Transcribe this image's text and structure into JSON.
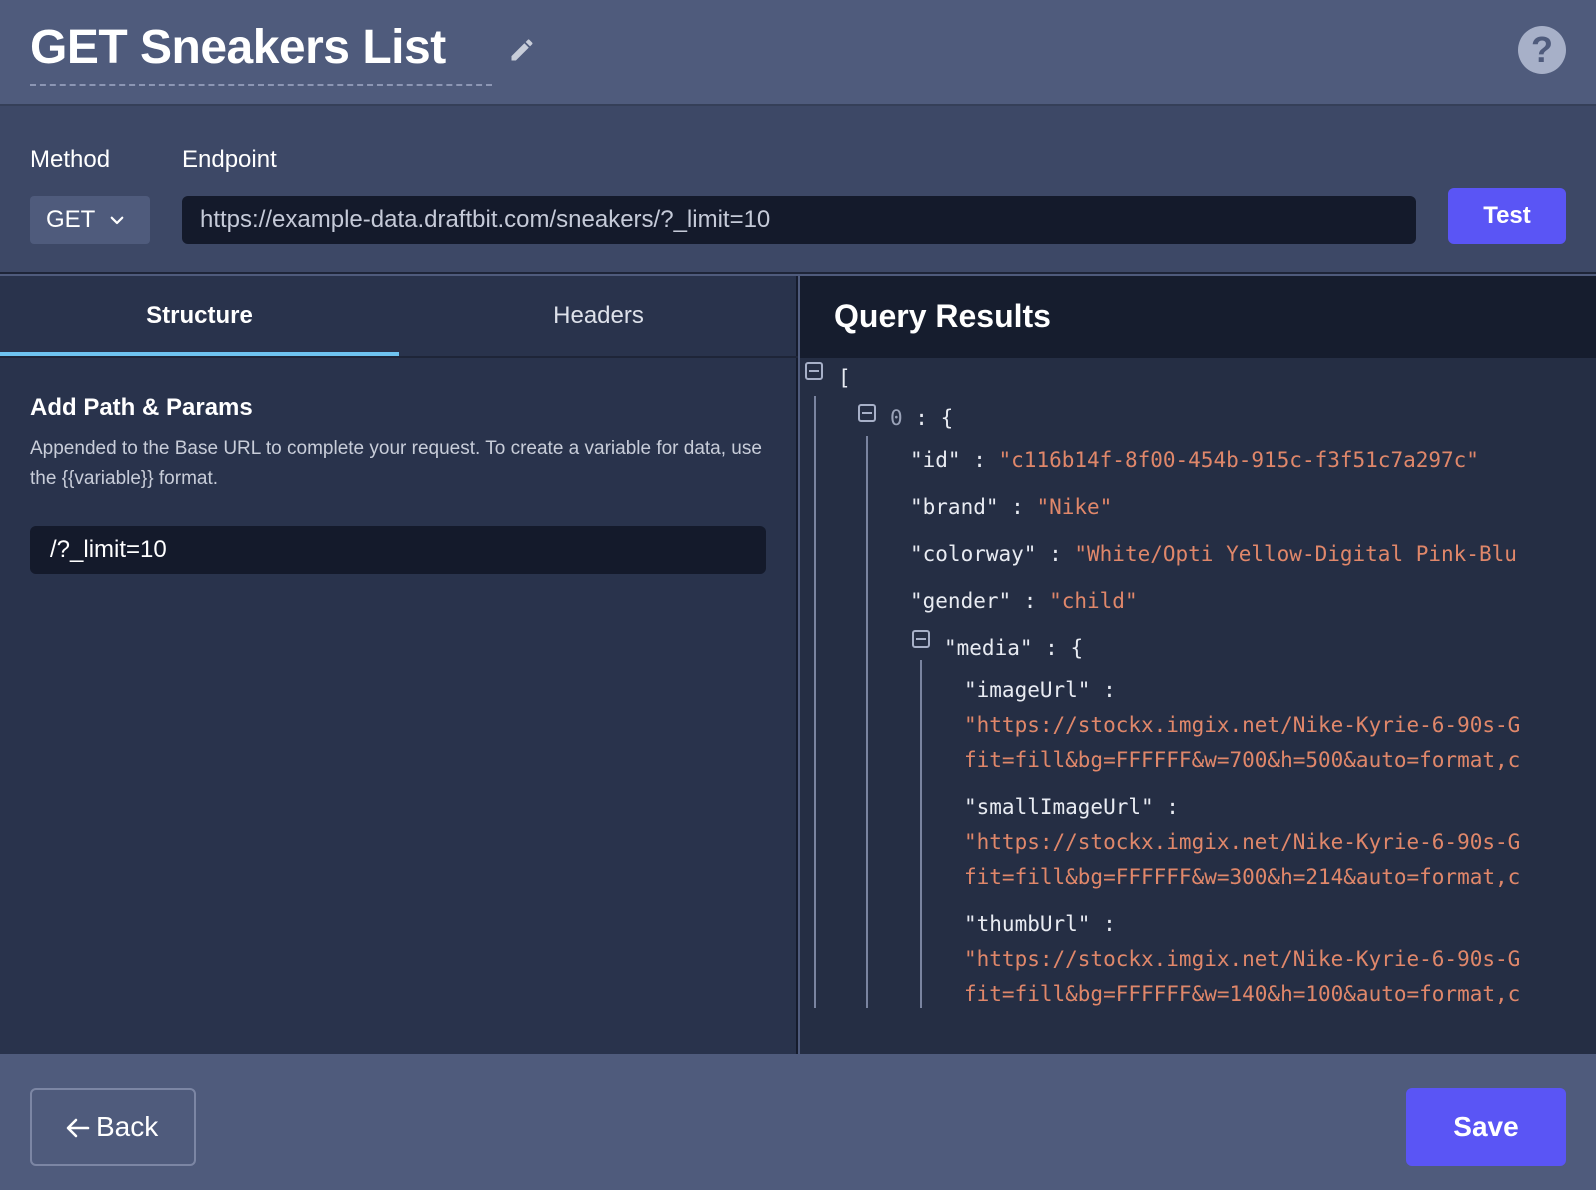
{
  "header": {
    "title": "GET Sneakers List",
    "help_label": "?"
  },
  "request": {
    "method_label": "Method",
    "endpoint_label": "Endpoint",
    "method_value": "GET",
    "endpoint_value": "https://example-data.draftbit.com/sneakers/?_limit=10",
    "test_label": "Test"
  },
  "tabs": {
    "structure": "Structure",
    "headers": "Headers"
  },
  "structure": {
    "title": "Add Path & Params",
    "description": "Appended to the Base URL to complete your request. To create a variable for data, use the {{variable}} format.",
    "path_value": "/?_limit=10"
  },
  "results": {
    "title": "Query Results",
    "open_bracket": "[",
    "item_index": "0",
    "open_brace": "{",
    "id_key": "\"id\"",
    "id_value": "\"c116b14f-8f00-454b-915c-f3f51c7a297c\"",
    "brand_key": "\"brand\"",
    "brand_value": "\"Nike\"",
    "colorway_key": "\"colorway\"",
    "colorway_value": "\"White/Opti Yellow-Digital Pink-Blu",
    "gender_key": "\"gender\"",
    "gender_value": "\"child\"",
    "media_key": "\"media\"",
    "imageUrl_key": "\"imageUrl\"",
    "imageUrl_value_1": "\"https://stockx.imgix.net/Nike-Kyrie-6-90s-G",
    "imageUrl_value_2": "fit=fill&bg=FFFFFF&w=700&h=500&auto=format,c",
    "smallImageUrl_key": "\"smallImageUrl\"",
    "smallImageUrl_value_1": "\"https://stockx.imgix.net/Nike-Kyrie-6-90s-G",
    "smallImageUrl_value_2": "fit=fill&bg=FFFFFF&w=300&h=214&auto=format,c",
    "thumbUrl_key": "\"thumbUrl\"",
    "thumbUrl_value_1": "\"https://stockx.imgix.net/Nike-Kyrie-6-90s-G",
    "thumbUrl_value_2": "fit=fill&bg=FFFFFF&w=140&h=100&auto=format,c"
  },
  "footer": {
    "back_label": "Back",
    "save_label": "Save"
  },
  "colors": {
    "accent": "#5a55f5",
    "tab_indicator": "#6ec3f0",
    "json_string": "#e0876a"
  }
}
